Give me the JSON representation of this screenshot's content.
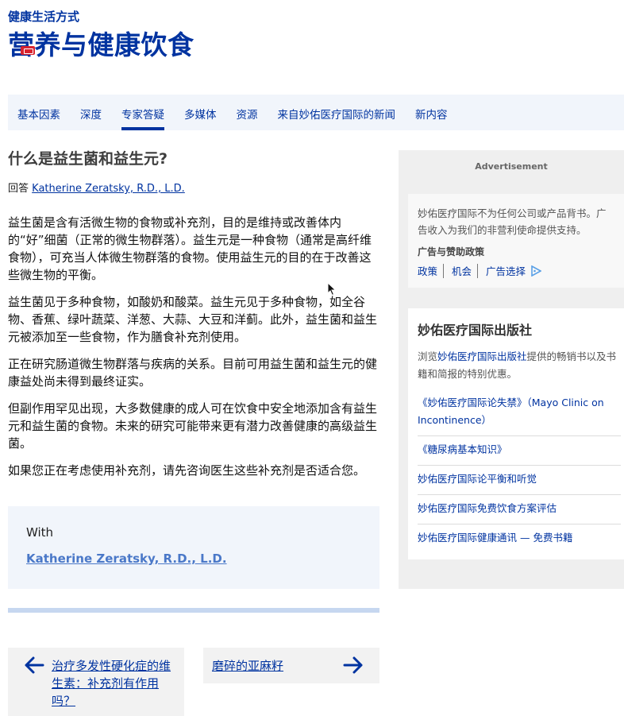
{
  "header": {
    "eyebrow": "健康生活方式",
    "title": "营养与健康饮食"
  },
  "tabs": [
    {
      "label": "基本因素",
      "active": false
    },
    {
      "label": "深度",
      "active": false
    },
    {
      "label": "专家答疑",
      "active": true
    },
    {
      "label": "多媒体",
      "active": false
    },
    {
      "label": "资源",
      "active": false
    },
    {
      "label": "来自妙佑医疗国际的新闻",
      "active": false
    },
    {
      "label": "新内容",
      "active": false
    }
  ],
  "article": {
    "question": "什么是益生菌和益生元?",
    "answer_prefix": "回答",
    "author": "Katherine Zeratsky, R.D., L.D.",
    "paragraphs": [
      "益生菌是含有活微生物的食物或补充剂，目的是维持或改善体内的“好”细菌（正常的微生物群落）。益生元是一种食物（通常是高纤维食物），可充当人体微生物群落的食物。使用益生元的目的在于改善这些微生物的平衡。",
      "益生菌见于多种食物，如酸奶和酸菜。益生元见于多种食物，如全谷物、香蕉、绿叶蔬菜、洋葱、大蒜、大豆和洋蓟。此外，益生菌和益生元被添加至一些食物，作为膳食补充剂使用。",
      "正在研究肠道微生物群落与疾病的关系。目前可用益生菌和益生元的健康益处尚未得到最终证实。",
      "但副作用罕见出现，大多数健康的成人可在饮食中安全地添加含有益生元和益生菌的食物。未来的研究可能带来更有潜力改善健康的高级益生菌。",
      "如果您正在考虑使用补充剂，请先咨询医生这些补充剂是否适合您。"
    ]
  },
  "author_box": {
    "with_label": "With",
    "author_link": "Katherine Zeratsky, R.D., L.D."
  },
  "pagination": {
    "prev": "治疗多发性硬化症的维生素：补充剂有作用吗？",
    "next": "磨碎的亚麻籽"
  },
  "sidebar": {
    "ad_label": "Advertisement",
    "ad_notice": "妙佑医疗国际不为任何公司或产品背书。广告收入为我们的非营利使命提供支持。",
    "ad_policy_title": "广告与赞助政策",
    "ad_links": [
      "政策",
      "机会",
      "广告选择"
    ],
    "publishing": {
      "title": "妙佑医疗国际出版社",
      "desc_prefix": "浏览",
      "desc_link": "妙佑医疗国际出版社",
      "desc_suffix": "提供的畅销书以及书籍和简报的特别优惠。",
      "items": [
        "《妙佑医疗国际论失禁》（Mayo Clinic on Incontinence）",
        "《糖尿病基本知识》",
        "妙佑医疗国际论平衡和听觉",
        "妙佑医疗国际免费饮食方案评估",
        "妙佑医疗国际健康通讯 — 免费书籍"
      ]
    }
  },
  "colors": {
    "brand_blue": "#0033a0",
    "tab_bg": "#f1f5fb",
    "sidebar_bg": "#efefef"
  }
}
